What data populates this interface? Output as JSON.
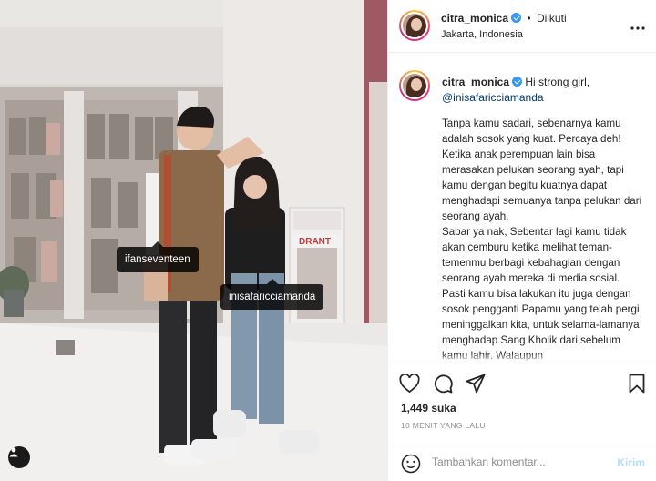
{
  "photo": {
    "tags": [
      "ifanseventeen",
      "inisafaricciamanda"
    ],
    "store_sign": "DRANT"
  },
  "header": {
    "username": "citra_monica",
    "follow_dot": "•",
    "follow_status": "Diikuti",
    "location": "Jakarta, Indonesia",
    "more_icon": "more-horizontal-icon"
  },
  "caption": {
    "username": "citra_monica",
    "greeting": "Hi strong girl,",
    "mention": "@inisafaricciamanda",
    "paragraphs": [
      "Tanpa kamu sadari, sebenarnya kamu adalah sosok yang kuat. Percaya deh! Ketika anak perempuan lain bisa merasakan pelukan seorang ayah, tapi kamu dengan begitu kuatnya dapat menghadapi semuanya tanpa pelukan dari seorang ayah.",
      "Sabar ya nak, Sebentar lagi kamu tidak akan cemburu ketika melihat teman-temenmu berbagi kebahagian dengan seorang ayah mereka di media sosial. Pasti kamu bisa lakukan itu juga dengan sosok pengganti Papamu yang telah pergi meninggalkan kita, untuk selama-lamanya menghadap Sang Kholik dari sebelum kamu lahir. Walaupun"
    ]
  },
  "actions": {
    "likes": "1,449 suka",
    "timestamp": "10 MENIT YANG LALU"
  },
  "comment": {
    "placeholder": "Tambahkan komentar...",
    "post_label": "Kirim"
  },
  "colors": {
    "link": "#00376b",
    "verified": "#3897f0",
    "post_disabled": "#b2dffc",
    "muted": "#8e8e8e"
  }
}
